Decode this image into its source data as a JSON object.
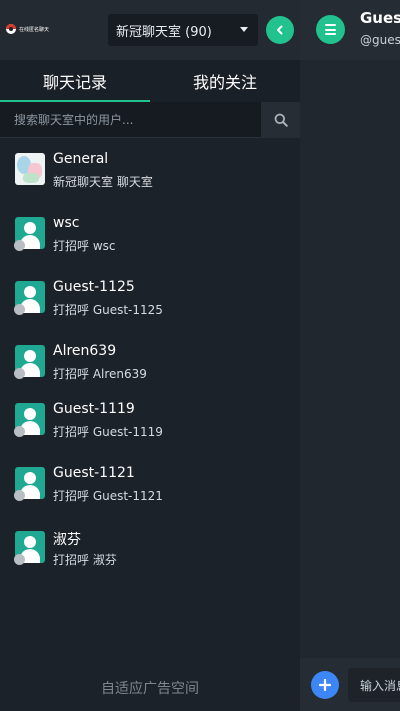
{
  "app": {
    "logo_text": "在线匿名聊天"
  },
  "room": {
    "selected": "新冠聊天室 (90)"
  },
  "tabs": [
    {
      "label": "聊天记录",
      "active": true
    },
    {
      "label": "我的关注",
      "active": false
    }
  ],
  "search": {
    "placeholder": "搜索聊天室中的用户..."
  },
  "users": [
    {
      "name": "General",
      "subtitle": "新冠聊天室 聊天室"
    },
    {
      "name": "wsc",
      "subtitle": "打招呼 wsc"
    },
    {
      "name": "Guest-1125",
      "subtitle": "打招呼 Guest-1125"
    },
    {
      "name": "Alren639",
      "subtitle": "打招呼 Alren639"
    },
    {
      "name": "Guest-1119",
      "subtitle": "打招呼 Guest-1119"
    },
    {
      "name": "Guest-1121",
      "subtitle": "打招呼 Guest-1121"
    },
    {
      "name": "淑芬",
      "subtitle": "打招呼 淑芬"
    }
  ],
  "ad": {
    "text": "自适应广告空间"
  },
  "chat": {
    "title": "Guest-",
    "handle": "@guest",
    "input_placeholder": "输入消息"
  },
  "colors": {
    "accent": "#21c28e",
    "add_button": "#3d86f5"
  },
  "icons": {
    "collapse": "chevron-left-icon",
    "search": "search-icon",
    "menu": "hamburger-menu-icon",
    "add": "plus-icon",
    "avatar": "user-avatar-icon"
  }
}
